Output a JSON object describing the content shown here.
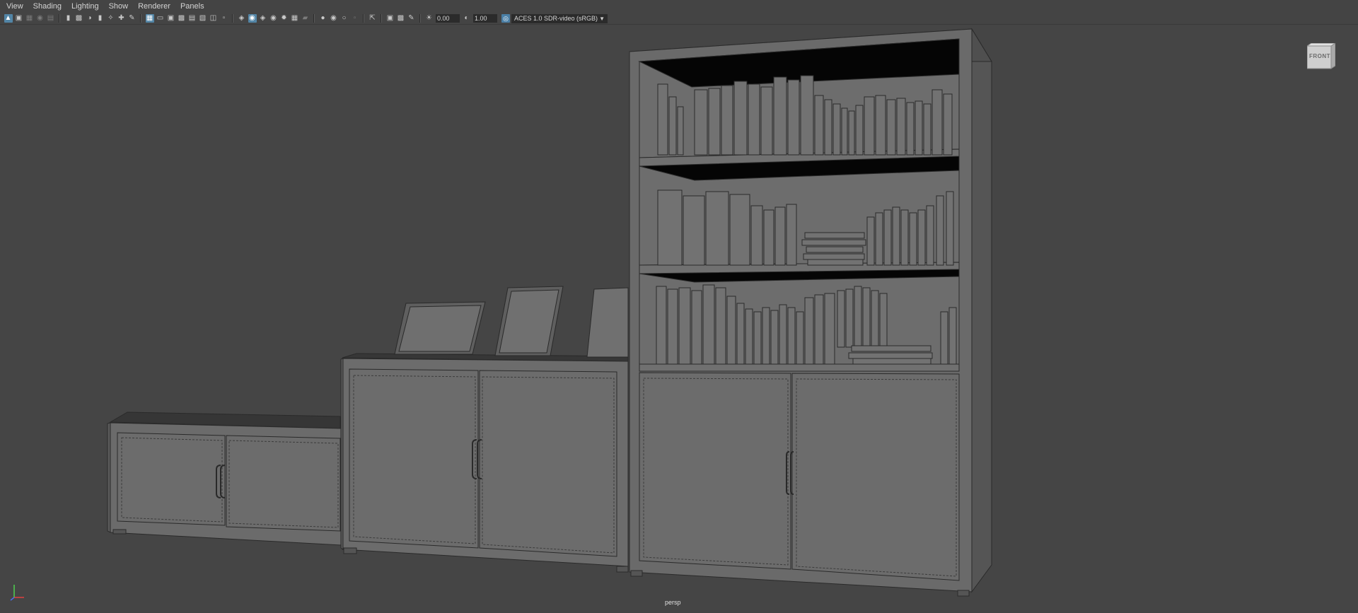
{
  "menu": [
    "View",
    "Shading",
    "Lighting",
    "Show",
    "Renderer",
    "Panels"
  ],
  "toolbar": {
    "exposure_value": "0.00",
    "gamma_value": "1.00",
    "color_space": "ACES 1.0 SDR-video (sRGB)"
  },
  "viewport": {
    "camera_label": "persp",
    "viewcube_label": "FRONT"
  },
  "colors": {
    "background": "#454545",
    "toolbar_active": "#5285a6",
    "model_fill": "#6e6e6e"
  },
  "icons": [
    "select-camera-icon",
    "camera-icon",
    "grid-icon",
    "wireframe-icon",
    "smooth-shade-icon",
    "lighting-icon",
    "isolate-icon",
    "xray-icon",
    "exposure-icon",
    "gamma-icon",
    "color-management-icon"
  ]
}
